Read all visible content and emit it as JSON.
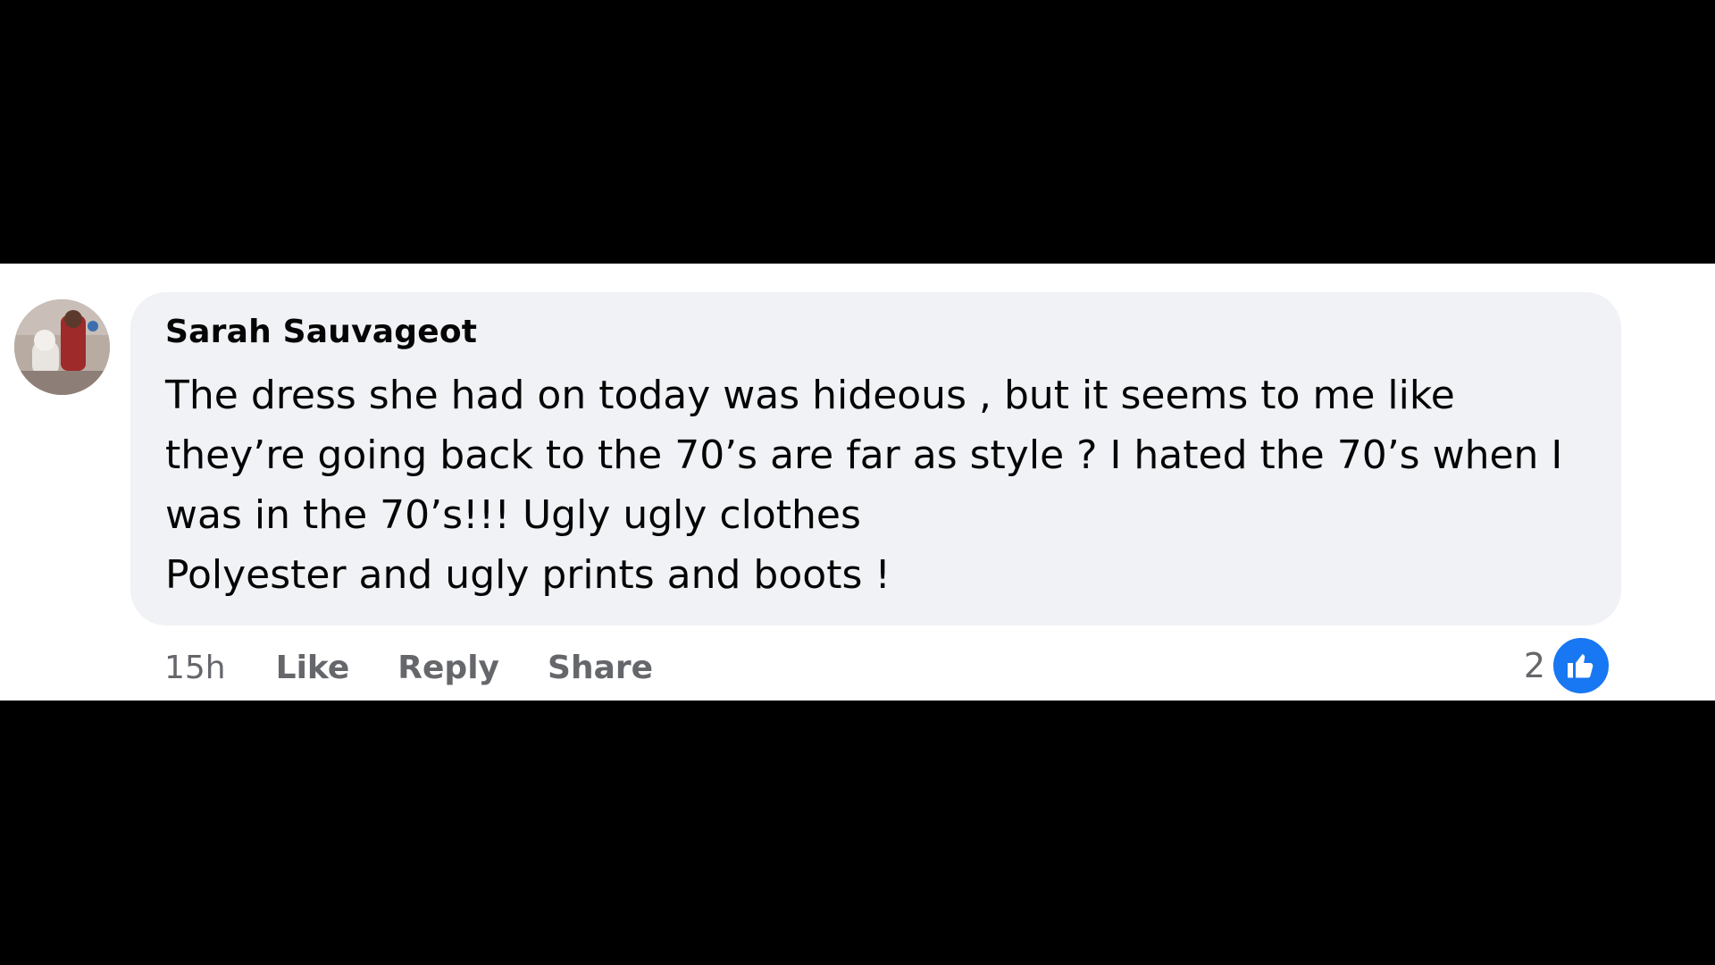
{
  "comment": {
    "author": "Sarah Sauvageot",
    "text": "The dress she had on today was hideous , but it seems to me like\nthey’re going back to the 70’s are far as style ? I hated the 70’s when I\nwas in the 70’s!!! Ugly ugly clothes\nPolyester and ugly prints and boots !",
    "timestamp": "15h",
    "actions": {
      "like": "Like",
      "reply": "Reply",
      "share": "Share"
    },
    "reactions": {
      "count": "2",
      "type_icon": "like-icon",
      "color": "#1877f2"
    }
  },
  "colors": {
    "bubble_bg": "#f0f2f5",
    "text": "#050505",
    "secondary_text": "#65676b",
    "letterbox": "#000000"
  }
}
